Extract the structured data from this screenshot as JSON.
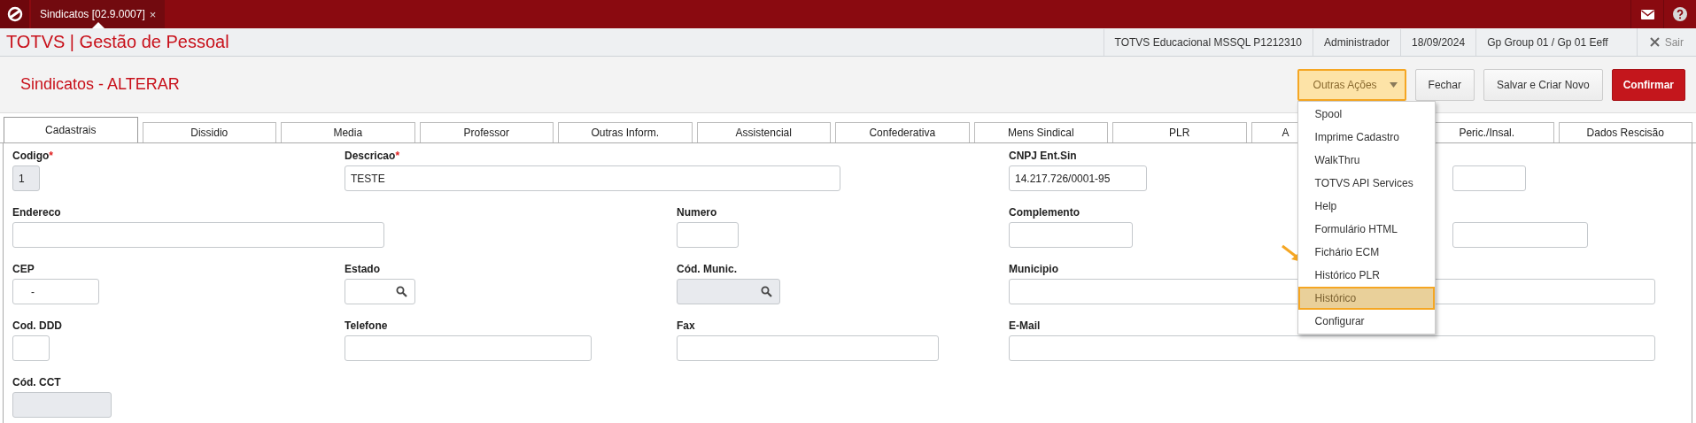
{
  "top_bar": {
    "tab": {
      "label": "Sindicatos [02.9.0007]",
      "close": "×"
    }
  },
  "header": {
    "app_title": "TOTVS | Gestão de Pessoal",
    "info": [
      "TOTVS Educacional MSSQL P1212310",
      "Administrador",
      "18/09/2024",
      "Gp Group 01 / Gp 01 Eeff"
    ],
    "exit": "Sair"
  },
  "page_title": "Sindicatos - ALTERAR",
  "actions": [
    {
      "label": "Outras Ações",
      "kind": "dropdown",
      "expanded": true
    },
    {
      "label": "Fechar",
      "kind": "default"
    },
    {
      "label": "Salvar e Criar Novo",
      "kind": "default"
    },
    {
      "label": "Confirmar",
      "kind": "primary"
    }
  ],
  "menu": [
    {
      "label": "Spool",
      "selected": false
    },
    {
      "label": "Imprime Cadastro",
      "selected": false
    },
    {
      "label": "WalkThru",
      "selected": false
    },
    {
      "label": "TOTVS API Services",
      "selected": false
    },
    {
      "label": "Help",
      "selected": false
    },
    {
      "label": "Formulário HTML",
      "selected": false
    },
    {
      "label": "Fichário ECM",
      "selected": false
    },
    {
      "label": "Histórico PLR",
      "selected": false
    },
    {
      "label": "Histórico",
      "selected": true
    },
    {
      "label": "Configurar",
      "selected": false
    }
  ],
  "tabs": [
    {
      "label": "Cadastrais",
      "selected": true,
      "kind": "full"
    },
    {
      "label": "Dissidio",
      "selected": false,
      "kind": "full"
    },
    {
      "label": "Media",
      "selected": false,
      "kind": "full"
    },
    {
      "label": "Professor",
      "selected": false,
      "kind": "full"
    },
    {
      "label": "Outras Inform.",
      "selected": false,
      "kind": "full"
    },
    {
      "label": "Assistencial",
      "selected": false,
      "kind": "full"
    },
    {
      "label": "Confederativa",
      "selected": false,
      "kind": "full"
    },
    {
      "label": "Mens Sindical",
      "selected": false,
      "kind": "full"
    },
    {
      "label": "PLR",
      "selected": false,
      "kind": "full"
    },
    {
      "label": "A",
      "selected": false,
      "kind": "covered"
    },
    {
      "label": "Peric./Insal.",
      "selected": false,
      "kind": "full"
    },
    {
      "label": "Dados Rescisão",
      "selected": false,
      "kind": "full"
    }
  ],
  "form_rows": [
    [
      {
        "label": "Codigo",
        "marker": "*",
        "value": "1",
        "disabled": true,
        "kind": "text"
      },
      {
        "label": "Descricao",
        "marker": "*",
        "value": "TESTE",
        "disabled": false,
        "kind": "text"
      },
      {
        "label": "CNPJ Ent.Sin",
        "value": "14.217.726/0001-95",
        "disabled": false,
        "kind": "text"
      },
      {
        "disabled": false,
        "kind": "text"
      }
    ],
    [
      {
        "label": "Endereco",
        "disabled": false,
        "kind": "text"
      },
      {
        "label": "Numero",
        "disabled": false,
        "kind": "text"
      },
      {
        "label": "Complemento",
        "disabled": false,
        "kind": "text"
      },
      {
        "disabled": false,
        "kind": "text"
      }
    ],
    [
      {
        "label": "CEP",
        "value": "-",
        "disabled": false,
        "kind": "mask"
      },
      {
        "label": "Estado",
        "disabled": false,
        "kind": "lookup"
      },
      {
        "label": "Cód. Munic.",
        "disabled": true,
        "kind": "lookup"
      },
      {
        "label": "Municipio",
        "disabled": false,
        "kind": "text"
      }
    ],
    [
      {
        "label": "Cod. DDD",
        "disabled": false,
        "kind": "text"
      },
      {
        "label": "Telefone",
        "disabled": false,
        "kind": "text"
      },
      {
        "label": "Fax",
        "disabled": false,
        "kind": "text"
      },
      {
        "label": "E-Mail",
        "disabled": false,
        "kind": "text"
      }
    ],
    [
      {
        "label": "Cód. CCT",
        "disabled": true,
        "kind": "text"
      }
    ]
  ]
}
